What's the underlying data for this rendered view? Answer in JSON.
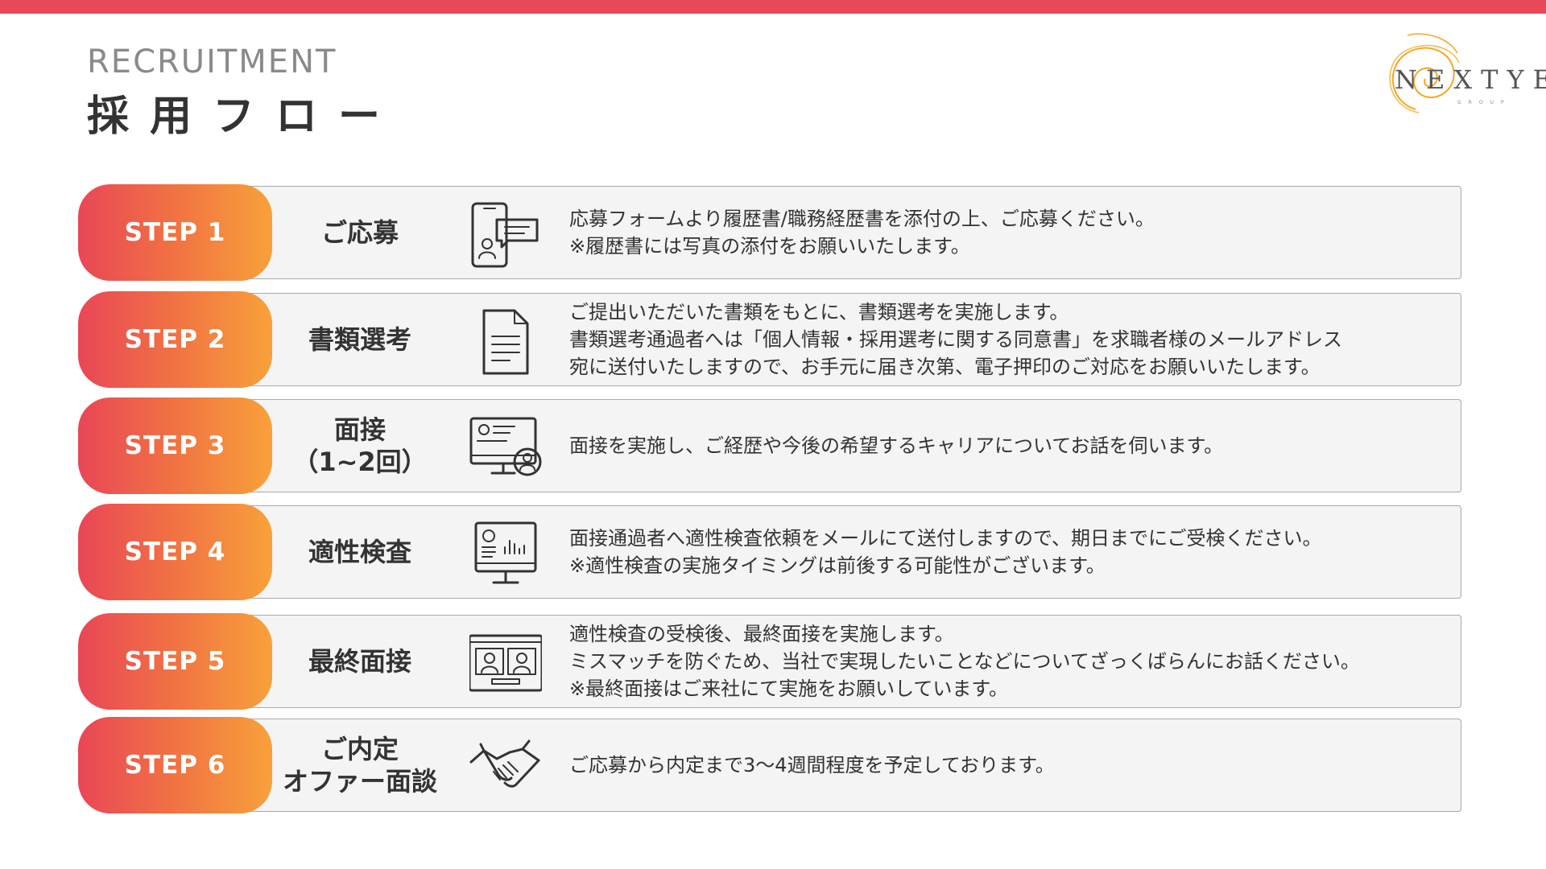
{
  "header": {
    "subtitle": "RECRUITMENT",
    "title": "採用フロー"
  },
  "logo": {
    "text": "NEXTYEAR",
    "subtext": "GROUP"
  },
  "colors": {
    "accent_bar": "#e8495a",
    "badge_gradient_start": "#e94657",
    "badge_gradient_end": "#f8a13a"
  },
  "steps": [
    {
      "badge": "STEP 1",
      "name": [
        "ご応募"
      ],
      "icon": "smartphone-chat-icon",
      "description": [
        "応募フォームより履歴書/職務経歴書を添付の上、ご応募ください。",
        "※履歴書には写真の添付をお願いいたします。"
      ]
    },
    {
      "badge": "STEP 2",
      "name": [
        "書類選考"
      ],
      "icon": "document-icon",
      "description": [
        "ご提出いただいた書類をもとに、書類選考を実施します。",
        "書類選考通過者へは「個人情報・採用選考に関する同意書」を求職者様のメールアドレス",
        "宛に送付いたしますので、お手元に届き次第、電子押印のご対応をお願いいたします。"
      ]
    },
    {
      "badge": "STEP 3",
      "name": [
        "面接",
        "（1~2回）"
      ],
      "icon": "monitor-profile-icon",
      "description": [
        "面接を実施し、ご経歴や今後の希望するキャリアについてお話を伺います。"
      ]
    },
    {
      "badge": "STEP 4",
      "name": [
        "適性検査"
      ],
      "icon": "monitor-chart-icon",
      "description": [
        "面接通過者へ適性検査依頼をメールにて送付しますので、期日までにご受検ください。",
        "※適性検査の実施タイミングは前後する可能性がございます。"
      ]
    },
    {
      "badge": "STEP 5",
      "name": [
        "最終面接"
      ],
      "icon": "video-call-icon",
      "description": [
        "適性検査の受検後、最終面接を実施します。",
        "ミスマッチを防ぐため、当社で実現したいことなどについてざっくばらんにお話ください。",
        "※最終面接はご来社にて実施をお願いしています。"
      ]
    },
    {
      "badge": "STEP 6",
      "name": [
        "ご内定",
        "オファー面談"
      ],
      "icon": "handshake-icon",
      "description": [
        "ご応募から内定まで3～4週間程度を予定しております。"
      ]
    }
  ]
}
